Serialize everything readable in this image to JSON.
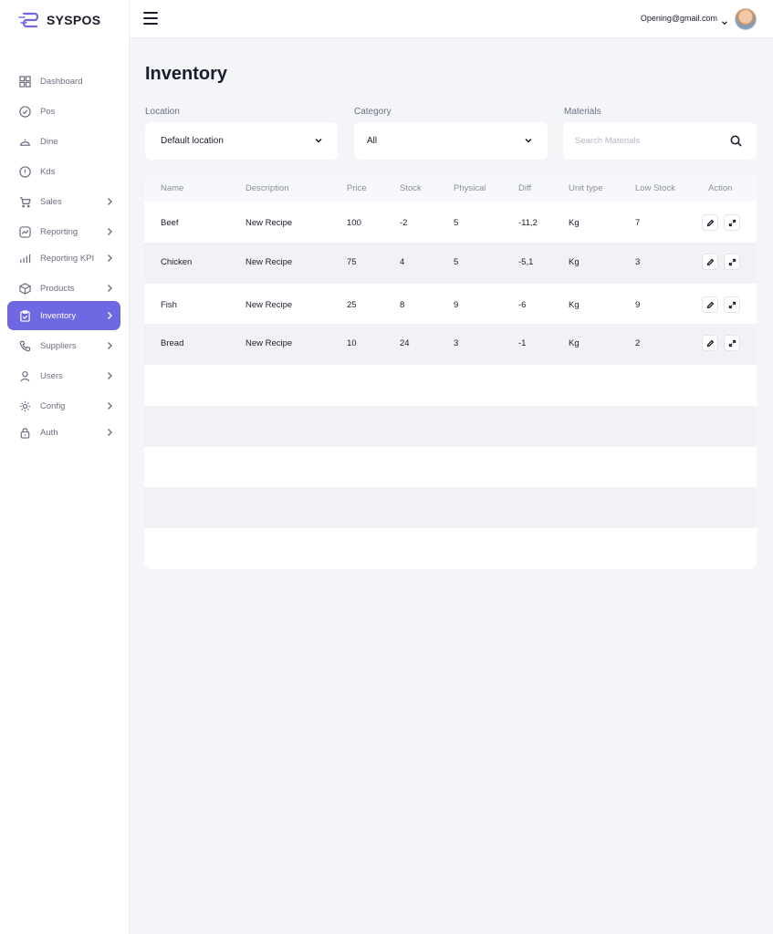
{
  "brand": {
    "name": "SYSPOS",
    "accent": "#6f68e3"
  },
  "sidebar": {
    "items": [
      {
        "label": "Dashboard",
        "icon": "grid-icon",
        "chevron": false,
        "active": false
      },
      {
        "label": "Pos",
        "icon": "check-circle-icon",
        "chevron": false,
        "active": false
      },
      {
        "label": "Dine",
        "icon": "cloche-icon",
        "chevron": false,
        "active": false
      },
      {
        "label": "Kds",
        "icon": "info-circle-icon",
        "chevron": false,
        "active": false
      },
      {
        "label": "Sales",
        "icon": "cart-icon",
        "chevron": true,
        "active": false
      },
      {
        "label": "Reporting",
        "icon": "chart-line-icon",
        "chevron": true,
        "active": false
      },
      {
        "label": "Reporting KPI",
        "icon": "bar-chart-icon",
        "chevron": true,
        "active": false
      },
      {
        "label": "Products",
        "icon": "box-icon",
        "chevron": true,
        "active": false
      },
      {
        "label": "Inventory",
        "icon": "clipboard-icon",
        "chevron": true,
        "active": true
      },
      {
        "label": "Suppliers",
        "icon": "phone-icon",
        "chevron": true,
        "active": false
      },
      {
        "label": "Users",
        "icon": "user-icon",
        "chevron": true,
        "active": false
      },
      {
        "label": "Config",
        "icon": "gear-icon",
        "chevron": true,
        "active": false
      },
      {
        "label": "Auth",
        "icon": "lock-icon",
        "chevron": true,
        "active": false
      }
    ]
  },
  "header": {
    "email": "Opening@gmail.com"
  },
  "main": {
    "title": "Inventory",
    "filters": {
      "location": {
        "label": "Location",
        "value": "Default location"
      },
      "category": {
        "label": "Category",
        "value": "All"
      },
      "materials": {
        "label": "Materials",
        "placeholder": "Search Materials"
      }
    },
    "table": {
      "columns": [
        "Name",
        "Description",
        "Price",
        "Stock",
        "Physical",
        "Diff",
        "Unit type",
        "Low Stock",
        "Action"
      ],
      "rows": [
        {
          "name": "Beef",
          "description": "New Recipe",
          "price": "100",
          "stock": "-2",
          "physical": "5",
          "diff": "-11,2",
          "unit": "Kg",
          "low_stock": "7"
        },
        {
          "name": "Chicken",
          "description": "New Recipe",
          "price": "75",
          "stock": "4",
          "physical": "5",
          "diff": "-5,1",
          "unit": "Kg",
          "low_stock": "3"
        },
        {
          "name": "Fish",
          "description": "New Recipe",
          "price": "25",
          "stock": "8",
          "physical": "9",
          "diff": "-6",
          "unit": "Kg",
          "low_stock": "9"
        },
        {
          "name": "Bread",
          "description": "New Recipe",
          "price": "10",
          "stock": "24",
          "physical": "3",
          "diff": "-1",
          "unit": "Kg",
          "low_stock": "2"
        }
      ]
    }
  }
}
